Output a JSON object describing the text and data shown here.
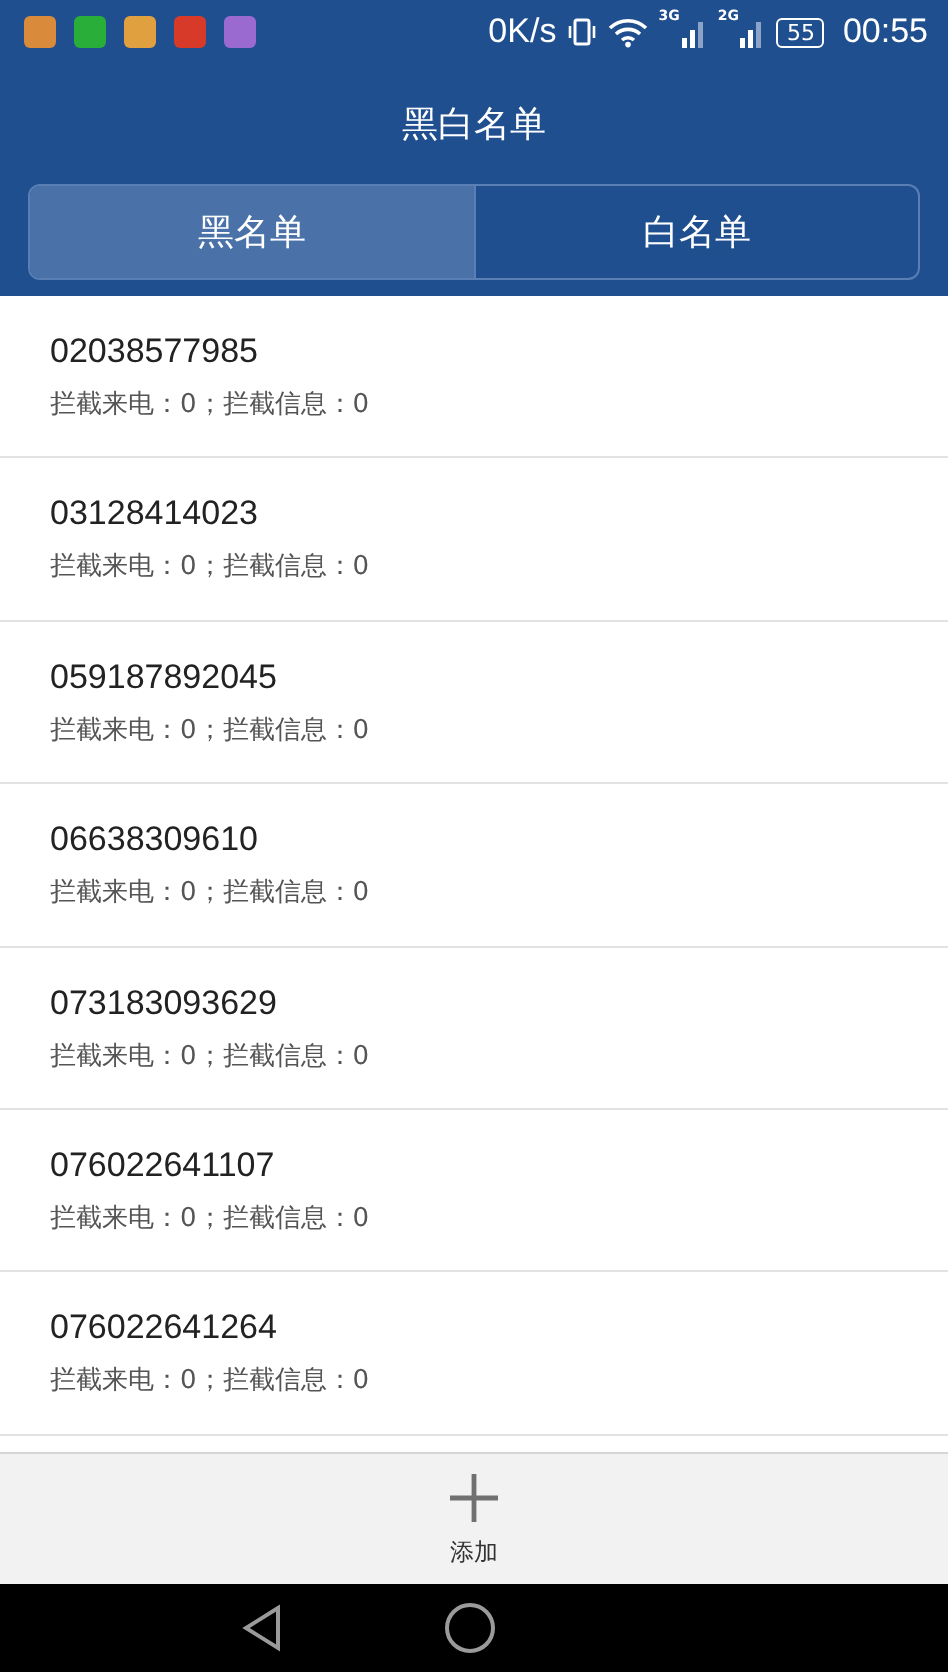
{
  "status_bar": {
    "app_icons": [
      {
        "color": "#d98a3a"
      },
      {
        "color": "#2aae3a"
      },
      {
        "color": "#e0a040"
      },
      {
        "color": "#d83a2a"
      },
      {
        "color": "#9a6ad0"
      }
    ],
    "speed": "0K/s",
    "network_labels": [
      "3G",
      "2G"
    ],
    "battery": "55",
    "time": "00:55"
  },
  "title": "黑白名单",
  "tabs": [
    {
      "label": "黑名单",
      "selected": true
    },
    {
      "label": "白名单",
      "selected": false
    }
  ],
  "entries": [
    {
      "number": "02038577985",
      "stats": "拦截来电：0；拦截信息：0"
    },
    {
      "number": "03128414023",
      "stats": "拦截来电：0；拦截信息：0"
    },
    {
      "number": "059187892045",
      "stats": "拦截来电：0；拦截信息：0"
    },
    {
      "number": "06638309610",
      "stats": "拦截来电：0；拦截信息：0"
    },
    {
      "number": "073183093629",
      "stats": "拦截来电：0；拦截信息：0"
    },
    {
      "number": "076022641107",
      "stats": "拦截来电：0；拦截信息：0"
    },
    {
      "number": "076022641264",
      "stats": "拦截来电：0；拦截信息：0"
    }
  ],
  "add_button": {
    "label": "添加"
  }
}
